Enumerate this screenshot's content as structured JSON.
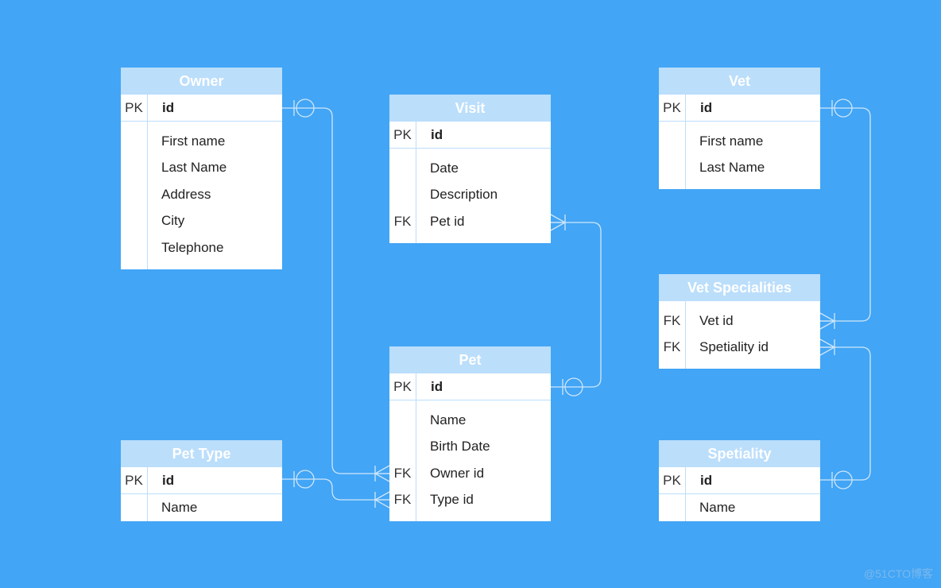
{
  "colors": {
    "background": "#42a5f5",
    "header": "#bbdefb",
    "line": "#cfe6fb"
  },
  "tables": [
    {
      "id": "owner",
      "title": "Owner",
      "pk": {
        "key": "PK",
        "name": "id"
      },
      "rows": [
        {
          "key": "",
          "name": "First name"
        },
        {
          "key": "",
          "name": "Last Name"
        },
        {
          "key": "",
          "name": "Address"
        },
        {
          "key": "",
          "name": "City"
        },
        {
          "key": "",
          "name": "Telephone"
        }
      ]
    },
    {
      "id": "visit",
      "title": "Visit",
      "pk": {
        "key": "PK",
        "name": "id"
      },
      "rows": [
        {
          "key": "",
          "name": "Date"
        },
        {
          "key": "",
          "name": "Description"
        },
        {
          "key": "FK",
          "name": "Pet id"
        }
      ]
    },
    {
      "id": "vet",
      "title": "Vet",
      "pk": {
        "key": "PK",
        "name": "id"
      },
      "rows": [
        {
          "key": "",
          "name": "First name"
        },
        {
          "key": "",
          "name": "Last Name"
        }
      ]
    },
    {
      "id": "vetspec",
      "title": "Vet Specialities",
      "pk": null,
      "rows": [
        {
          "key": "FK",
          "name": "Vet id"
        },
        {
          "key": "FK",
          "name": "Spetiality id"
        }
      ]
    },
    {
      "id": "pet",
      "title": "Pet",
      "pk": {
        "key": "PK",
        "name": "id"
      },
      "rows": [
        {
          "key": "",
          "name": "Name"
        },
        {
          "key": "",
          "name": "Birth Date"
        },
        {
          "key": "FK",
          "name": "Owner id"
        },
        {
          "key": "FK",
          "name": "Type id"
        }
      ]
    },
    {
      "id": "pettype",
      "title": "Pet Type",
      "pk": {
        "key": "PK",
        "name": "id"
      },
      "rows": [
        {
          "key": "",
          "name": "Name"
        }
      ]
    },
    {
      "id": "speciality",
      "title": "Spetiality",
      "pk": {
        "key": "PK",
        "name": "id"
      },
      "rows": [
        {
          "key": "",
          "name": "Name"
        }
      ]
    }
  ],
  "relationships": [
    {
      "from": "Owner.id",
      "to": "Pet.Owner id",
      "type": "one-to-many"
    },
    {
      "from": "Pet Type.id",
      "to": "Pet.Type id",
      "type": "one-to-many"
    },
    {
      "from": "Pet.id",
      "to": "Visit.Pet id",
      "type": "one-to-many"
    },
    {
      "from": "Vet.id",
      "to": "Vet Specialities.Vet id",
      "type": "one-to-many"
    },
    {
      "from": "Spetiality.id",
      "to": "Vet Specialities.Spetiality id",
      "type": "one-to-many"
    }
  ],
  "watermark": "@51CTO博客"
}
